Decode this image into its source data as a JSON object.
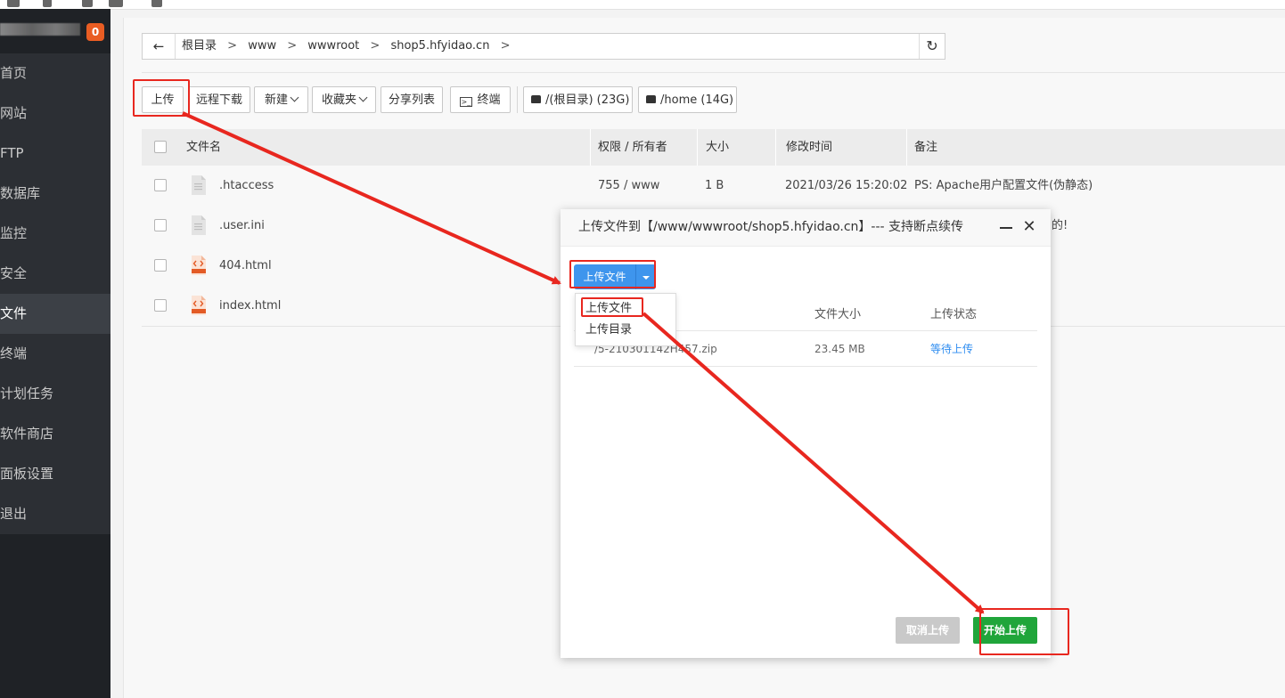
{
  "sidebar": {
    "badge": "0",
    "items": [
      {
        "label": "首页"
      },
      {
        "label": "网站"
      },
      {
        "label": "FTP"
      },
      {
        "label": "数据库"
      },
      {
        "label": "监控"
      },
      {
        "label": "安全"
      },
      {
        "label": "文件"
      },
      {
        "label": "终端"
      },
      {
        "label": "计划任务"
      },
      {
        "label": "软件商店"
      },
      {
        "label": "面板设置"
      },
      {
        "label": "退出"
      }
    ],
    "active": "文件"
  },
  "pathbar": {
    "back_icon": "arrow-left-icon",
    "crumbs": [
      "根目录",
      "www",
      "wwwroot",
      "shop5.hfyidao.cn"
    ],
    "separator": ">",
    "refresh_icon": "refresh-icon"
  },
  "toolbar": {
    "upload": "上传",
    "remote_download": "远程下载",
    "new": "新建",
    "favorites": "收藏夹",
    "share_list": "分享列表",
    "terminal": "终端",
    "disk_root": "/(根目录) (23G)",
    "disk_home": "/home (14G)"
  },
  "table": {
    "headers": {
      "name": "文件名",
      "perm": "权限 / 所有者",
      "size": "大小",
      "mtime": "修改时间",
      "note": "备注"
    },
    "rows": [
      {
        "name": ".htaccess",
        "type": "text",
        "perm": "755 / www",
        "size": "1 B",
        "mtime": "2021/03/26 15:20:02",
        "note": "PS: Apache用户配置文件(伪静态)"
      },
      {
        "name": ".user.ini",
        "type": "text",
        "perm": "",
        "size": "",
        "mtime": "",
        "note": "的!"
      },
      {
        "name": "404.html",
        "type": "html",
        "perm": "",
        "size": "",
        "mtime": "",
        "note": ""
      },
      {
        "name": "index.html",
        "type": "html",
        "perm": "",
        "size": "",
        "mtime": "",
        "note": ""
      }
    ]
  },
  "modal": {
    "title": "上传文件到【/www/wwwroot/shop5.hfyidao.cn】--- 支持断点续传",
    "upload_button": "上传文件",
    "dropdown": [
      "上传文件",
      "上传目录"
    ],
    "columns": {
      "size": "文件大小",
      "status": "上传状态"
    },
    "files": [
      {
        "name": "/5-210301142H457.zip",
        "size": "23.45 MB",
        "status": "等待上传"
      }
    ],
    "cancel": "取消上传",
    "start": "开始上传"
  },
  "colors": {
    "sidebar_bg": "#2c2f34",
    "primary_blue": "#3e95ed",
    "green": "#20a53a",
    "badge_orange": "#e95d23",
    "annotation_red": "#e8271f",
    "status_blue": "#2d8cf0"
  }
}
